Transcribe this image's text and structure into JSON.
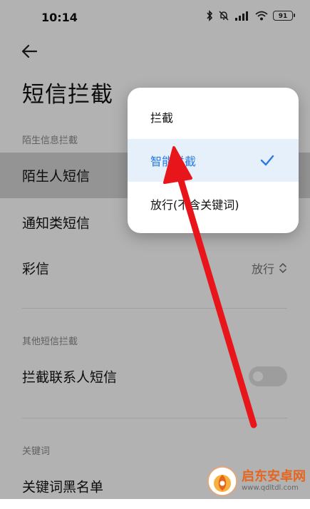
{
  "status_bar": {
    "time": "10:14",
    "battery": "91"
  },
  "header": {
    "title": "短信拦截"
  },
  "sections": [
    {
      "label": "陌生信息拦截"
    },
    {
      "label": "其他短信拦截"
    },
    {
      "label": "关键词"
    }
  ],
  "rows": {
    "stranger_sms": "陌生人短信",
    "notification_sms": "通知类短信",
    "mms": "彩信",
    "mms_value": "放行",
    "contact_sms": "拦截联系人短信",
    "keyword_blacklist": "关键词黑名单"
  },
  "popup": {
    "options": [
      "拦截",
      "智能拦截",
      "放行(不含关键词)"
    ],
    "selected_index": 1
  },
  "colors": {
    "accent": "#2a7ae2",
    "arrow": "#e8161b"
  },
  "watermark": {
    "title": "启东安卓网",
    "url": "www.qdltdl.com"
  }
}
